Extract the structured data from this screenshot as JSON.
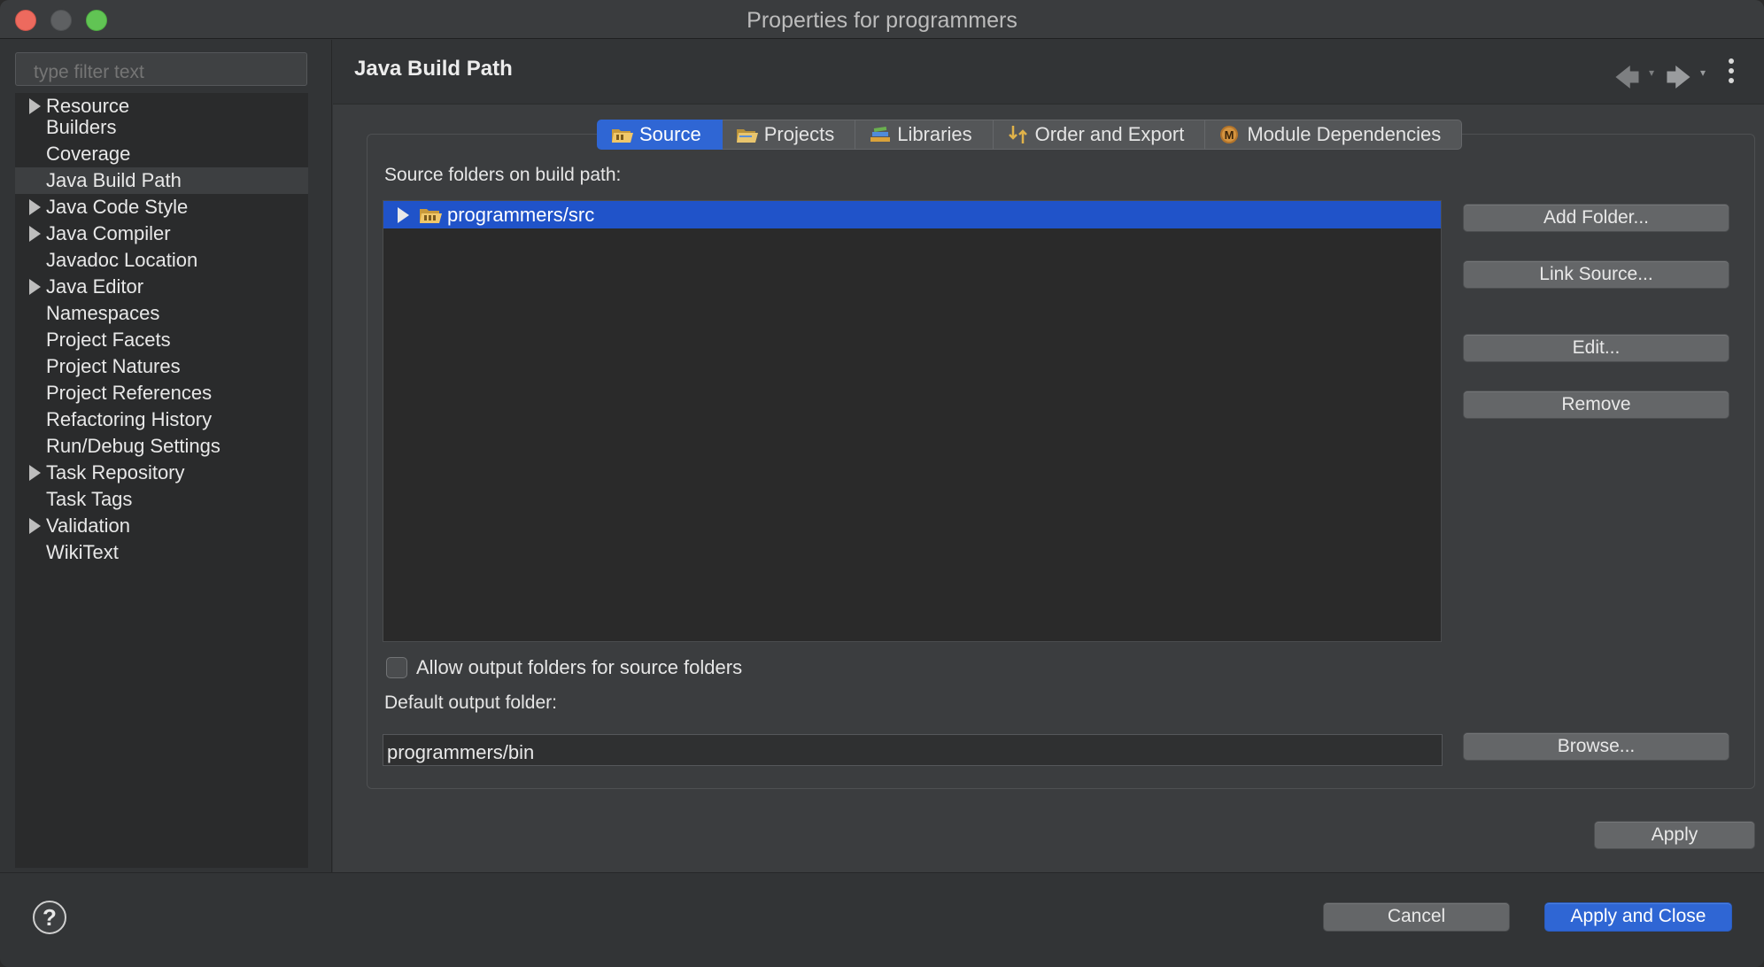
{
  "window": {
    "title": "Properties for programmers"
  },
  "sidebar": {
    "filter_placeholder": "type filter text",
    "items": [
      {
        "label": "Resource",
        "expandable": true
      },
      {
        "label": "Builders",
        "expandable": false
      },
      {
        "label": "Coverage",
        "expandable": false
      },
      {
        "label": "Java Build Path",
        "expandable": false,
        "selected": true
      },
      {
        "label": "Java Code Style",
        "expandable": true
      },
      {
        "label": "Java Compiler",
        "expandable": true
      },
      {
        "label": "Javadoc Location",
        "expandable": false
      },
      {
        "label": "Java Editor",
        "expandable": true
      },
      {
        "label": "Namespaces",
        "expandable": false
      },
      {
        "label": "Project Facets",
        "expandable": false
      },
      {
        "label": "Project Natures",
        "expandable": false
      },
      {
        "label": "Project References",
        "expandable": false
      },
      {
        "label": "Refactoring History",
        "expandable": false
      },
      {
        "label": "Run/Debug Settings",
        "expandable": false
      },
      {
        "label": "Task Repository",
        "expandable": true
      },
      {
        "label": "Task Tags",
        "expandable": false
      },
      {
        "label": "Validation",
        "expandable": true
      },
      {
        "label": "WikiText",
        "expandable": false
      }
    ]
  },
  "main": {
    "page_title": "Java Build Path",
    "tabs": [
      {
        "label": "Source",
        "icon": "source-folder-icon",
        "active": true
      },
      {
        "label": "Projects",
        "icon": "projects-folder-icon",
        "active": false
      },
      {
        "label": "Libraries",
        "icon": "libraries-icon",
        "active": false
      },
      {
        "label": "Order and Export",
        "icon": "order-export-icon",
        "active": false
      },
      {
        "label": "Module Dependencies",
        "icon": "module-icon",
        "active": false
      }
    ],
    "source_label": "Source folders on build path:",
    "source_folders": [
      {
        "path": "programmers/src",
        "selected": true
      }
    ],
    "buttons": {
      "add_folder": "Add Folder...",
      "link_source": "Link Source...",
      "edit": "Edit...",
      "remove": "Remove",
      "browse": "Browse...",
      "apply": "Apply"
    },
    "allow_output_label": "Allow output folders for source folders",
    "allow_output_checked": false,
    "default_output_label": "Default output folder:",
    "default_output_value": "programmers/bin"
  },
  "footer": {
    "help": "?",
    "cancel": "Cancel",
    "apply_and_close": "Apply and Close"
  },
  "colors": {
    "accent": "#2f66d4",
    "selection": "#2053c9"
  }
}
